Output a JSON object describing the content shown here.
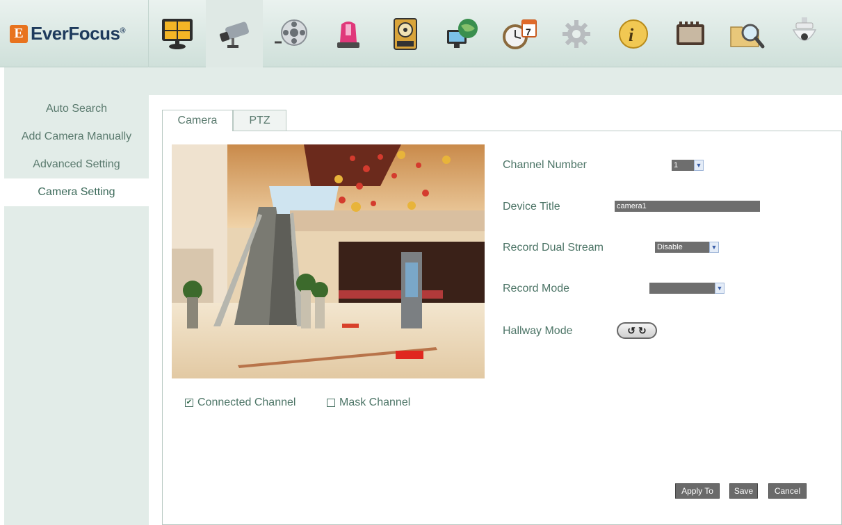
{
  "brand": {
    "mark": "E",
    "name": "EverFocus",
    "reg": "®"
  },
  "toolbar": {
    "items": [
      {
        "name": "live-view-icon"
      },
      {
        "name": "camera-icon"
      },
      {
        "name": "playback-icon"
      },
      {
        "name": "alarm-icon"
      },
      {
        "name": "storage-icon"
      },
      {
        "name": "network-icon"
      },
      {
        "name": "schedule-icon"
      },
      {
        "name": "settings-icon"
      },
      {
        "name": "info-icon"
      },
      {
        "name": "record-icon"
      },
      {
        "name": "search-icon"
      },
      {
        "name": "ptz-dome-icon"
      }
    ],
    "active": "camera-icon"
  },
  "sidebar": {
    "items": [
      {
        "label": "Auto Search"
      },
      {
        "label": "Add Camera Manually"
      },
      {
        "label": "Advanced Setting"
      },
      {
        "label": "Camera Setting"
      }
    ],
    "active_index": 3
  },
  "tabs": [
    {
      "label": "Camera"
    },
    {
      "label": "PTZ"
    }
  ],
  "form": {
    "channel_number": {
      "label": "Channel Number",
      "value": "1"
    },
    "device_title": {
      "label": "Device Title",
      "value": "camera1"
    },
    "record_dual_stream": {
      "label": "Record Dual Stream",
      "value": "Disable"
    },
    "record_mode": {
      "label": "Record Mode",
      "value": ""
    },
    "hallway_mode": {
      "label": "Hallway Mode",
      "left_symbol": "↺",
      "right_symbol": "↻"
    }
  },
  "checks": {
    "connected_channel": {
      "label": "Connected Channel",
      "checked": true,
      "mark": "✔"
    },
    "mask_channel": {
      "label": "Mask Channel",
      "checked": false,
      "mark": ""
    }
  },
  "buttons": {
    "apply_to": "Apply To",
    "save": "Save",
    "cancel": "Cancel"
  },
  "colors": {
    "accent": "#e8731e",
    "sidebar_bg": "#e2ece8",
    "text": "#4d7567",
    "control_bg": "#6e6e6e"
  }
}
